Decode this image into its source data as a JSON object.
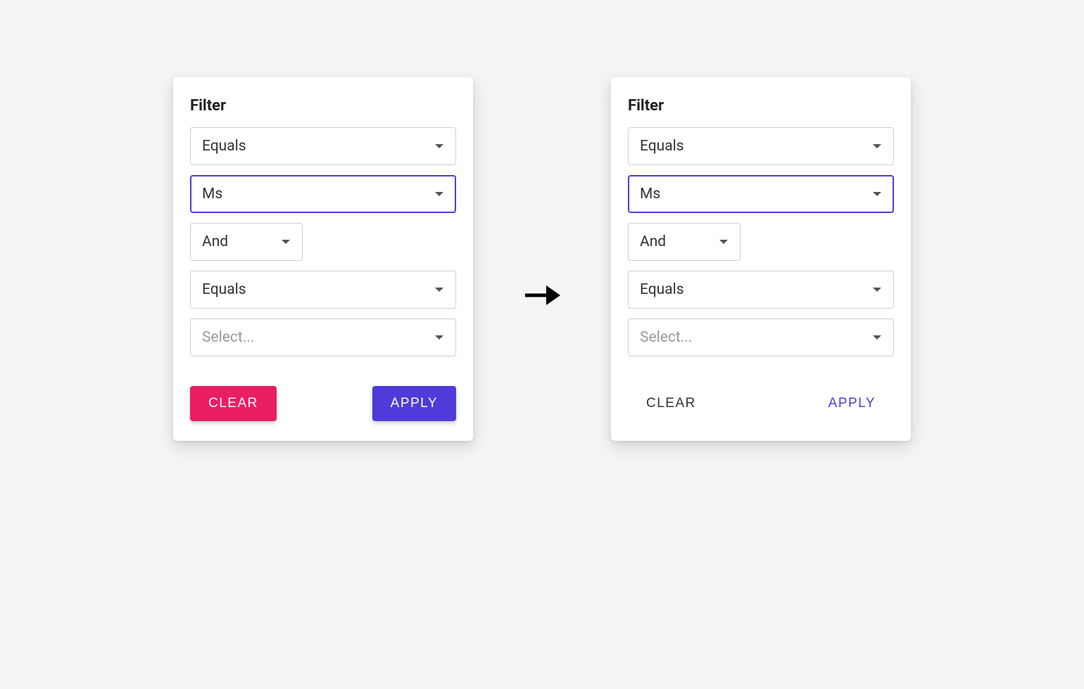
{
  "arrow_symbol": "→",
  "left": {
    "title": "Filter",
    "select_equals1": "Equals",
    "select_value1": "Ms",
    "select_logic": "And",
    "select_equals2": "Equals",
    "select_value2": "Select...",
    "clear_label": "CLEAR",
    "apply_label": "APPLY"
  },
  "right": {
    "title": "Filter",
    "select_equals1": "Equals",
    "select_value1": "Ms",
    "select_logic": "And",
    "select_equals2": "Equals",
    "select_value2": "Select...",
    "clear_label": "CLEAR",
    "apply_label": "APPLY"
  },
  "colors": {
    "accent_primary": "#4f3bda",
    "accent_secondary": "#e91e63",
    "border_default": "#cfcfcf",
    "text_default": "#333333",
    "text_placeholder": "#9a9a9a",
    "card_bg": "#ffffff",
    "page_bg": "#f5f5f5"
  }
}
